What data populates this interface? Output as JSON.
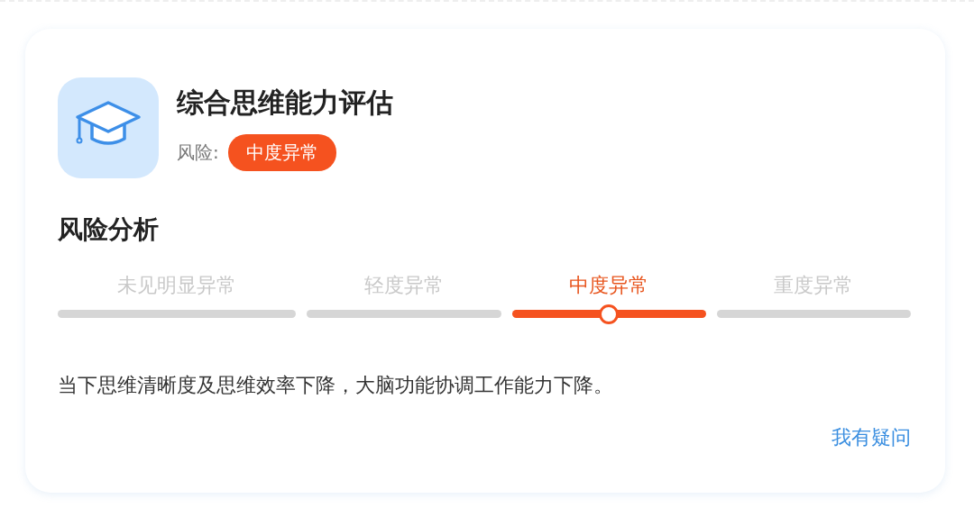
{
  "assessment": {
    "title": "综合思维能力评估",
    "risk_label": "风险:",
    "risk_badge": "中度异常"
  },
  "analysis": {
    "heading": "风险分析",
    "levels": [
      {
        "label": "未见明显异常",
        "selected": false
      },
      {
        "label": "轻度异常",
        "selected": false
      },
      {
        "label": "中度异常",
        "selected": true
      },
      {
        "label": "重度异常",
        "selected": false
      }
    ],
    "description": "当下思维清晰度及思维效率下降，大脑功能协调工作能力下降。",
    "link": "我有疑问"
  }
}
